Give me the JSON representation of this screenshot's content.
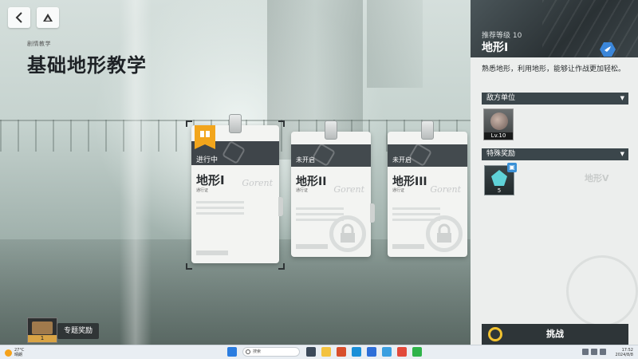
{
  "header": {
    "small_label": "剧情教学",
    "title": "基础地形教学"
  },
  "nav": {
    "back_icon": "chevron-left-icon",
    "home_icon": "triangle-home-icon"
  },
  "cards": [
    {
      "status": "进行中",
      "name": "地形I",
      "sub": "通行证",
      "signature": "Gorent",
      "locked": false
    },
    {
      "status": "未开启",
      "name": "地形II",
      "sub": "通行证",
      "signature": "Gorent",
      "locked": true
    },
    {
      "status": "未开启",
      "name": "地形III",
      "sub": "通行证",
      "signature": "Gorent",
      "locked": true
    }
  ],
  "reward_bottom": {
    "count": "1",
    "label": "专题奖励"
  },
  "panel": {
    "recommended_level": "推荐等级 10",
    "stage_name": "地形I",
    "description": "熟悉地形，利用地形，能够让作战更加轻松。",
    "enemy_section": "敌方单位",
    "enemy_level": "Lv.10",
    "special_section": "特殊奖励",
    "reward_qty": "5",
    "ghost_stage": "地形V",
    "challenge": "挑战"
  },
  "taskbar": {
    "weather_temp": "27°C",
    "weather_desc": "晴朗",
    "search": "搜索",
    "time": "17:52",
    "date": "2024/8/8"
  },
  "colors": {
    "accent": "#f2a51c",
    "band": "#434a4e",
    "panel_dark": "#2e3538",
    "badge": "#3b86d9"
  }
}
